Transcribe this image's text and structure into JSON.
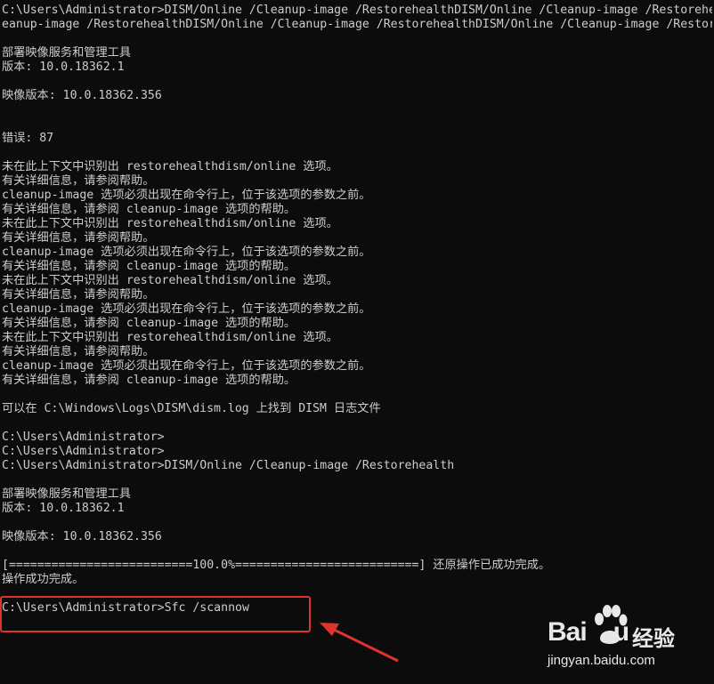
{
  "console": {
    "lines": [
      "C:\\Users\\Administrator>DISM/Online /Cleanup-image /RestorehealthDISM/Online /Cleanup-image /Restorehealth",
      "eanup-image /RestorehealthDISM/Online /Cleanup-image /RestorehealthDISM/Online /Cleanup-image /Restorehealth",
      "",
      "部署映像服务和管理工具",
      "版本: 10.0.18362.1",
      "",
      "映像版本: 10.0.18362.356",
      "",
      "",
      "错误: 87",
      "",
      "未在此上下文中识别出 restorehealthdism/online 选项。",
      "有关详细信息，请参阅帮助。",
      "cleanup-image 选项必须出现在命令行上，位于该选项的参数之前。",
      "有关详细信息，请参阅 cleanup-image 选项的帮助。",
      "未在此上下文中识别出 restorehealthdism/online 选项。",
      "有关详细信息，请参阅帮助。",
      "cleanup-image 选项必须出现在命令行上，位于该选项的参数之前。",
      "有关详细信息，请参阅 cleanup-image 选项的帮助。",
      "未在此上下文中识别出 restorehealthdism/online 选项。",
      "有关详细信息，请参阅帮助。",
      "cleanup-image 选项必须出现在命令行上，位于该选项的参数之前。",
      "有关详细信息，请参阅 cleanup-image 选项的帮助。",
      "未在此上下文中识别出 restorehealthdism/online 选项。",
      "有关详细信息，请参阅帮助。",
      "cleanup-image 选项必须出现在命令行上，位于该选项的参数之前。",
      "有关详细信息，请参阅 cleanup-image 选项的帮助。",
      "",
      "可以在 C:\\Windows\\Logs\\DISM\\dism.log 上找到 DISM 日志文件",
      "",
      "C:\\Users\\Administrator>",
      "C:\\Users\\Administrator>",
      "C:\\Users\\Administrator>DISM/Online /Cleanup-image /Restorehealth",
      "",
      "部署映像服务和管理工具",
      "版本: 10.0.18362.1",
      "",
      "映像版本: 10.0.18362.356",
      "",
      "[==========================100.0%==========================] 还原操作已成功完成。",
      "操作成功完成。",
      "",
      "C:\\Users\\Administrator>Sfc /scannow"
    ]
  },
  "annotation": {
    "highlight_color": "#e0322e",
    "arrow_color": "#e0322e"
  },
  "watermark": {
    "logo_text": "Bai",
    "logo_suffix": "u",
    "brand": "经验",
    "url": "jingyan.baidu.com"
  },
  "colors": {
    "background": "#0c0c0c",
    "text": "#cccccc"
  }
}
